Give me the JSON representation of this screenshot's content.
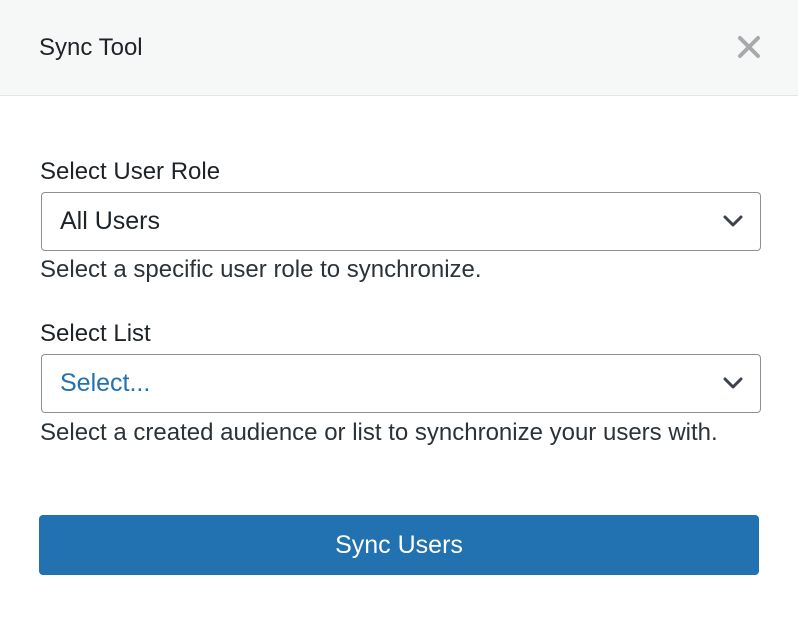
{
  "modal": {
    "title": "Sync Tool",
    "close_icon": "close-icon"
  },
  "role_field": {
    "label": "Select User Role",
    "selected_value": "All Users",
    "help_text": "Select a specific user role to synchronize.",
    "icon": "chevron-down-icon"
  },
  "list_field": {
    "label": "Select List",
    "placeholder": "Select...",
    "help_text": "Select a created audience or list to synchronize your users with.",
    "icon": "chevron-down-icon"
  },
  "actions": {
    "sync_label": "Sync Users"
  },
  "colors": {
    "primary": "#2271b1",
    "header_bg": "#f6f7f7",
    "text": "#1d2327",
    "close_icon": "#a7aaad"
  }
}
